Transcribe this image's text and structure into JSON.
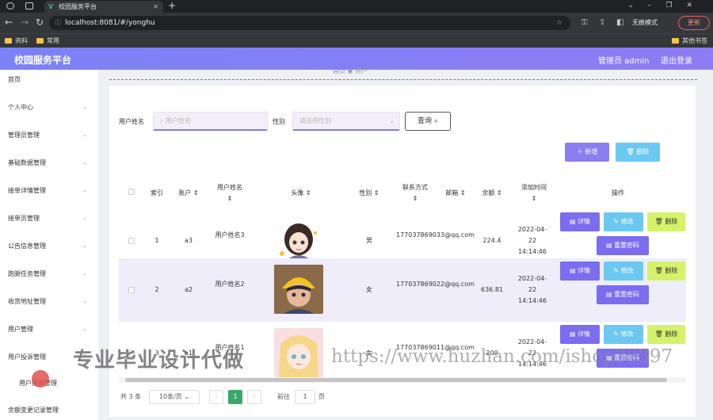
{
  "browser": {
    "tab_title": "校园服务平台",
    "url": "localhost:8081/#/yonghu",
    "incognito_label": "无痕模式",
    "update_label": "更新",
    "bookmarks": [
      "资料",
      "常用"
    ],
    "other_bookmarks": "其他书签"
  },
  "header": {
    "brand": "校园服务平台",
    "user": "管理员 admin",
    "logout": "退出登录"
  },
  "sidebar": {
    "items": [
      "首页",
      "个人中心",
      "管理员管理",
      "基础数据管理",
      "接单详情管理",
      "接单员管理",
      "公告信息管理",
      "跑腿任务管理",
      "收货地址管理",
      "用户管理",
      "用户投诉管理"
    ],
    "sub_item": "用户投诉管理",
    "last_item": "余额变更记录管理"
  },
  "breadcrumb": {
    "home": "首页",
    "current": "用户"
  },
  "search": {
    "name_label": "用户姓名",
    "name_placeholder": "用户姓名",
    "gender_label": "性别",
    "gender_placeholder": "请选择性别",
    "query_button": "查询"
  },
  "actions": {
    "add": "新增",
    "delete": "删除"
  },
  "table": {
    "columns": [
      "索引",
      "账户",
      "用户姓名",
      "头像",
      "性别",
      "联系方式",
      "邮箱",
      "余额",
      "添加时间",
      "操作"
    ],
    "rows": [
      {
        "index": "1",
        "account": "a3",
        "name": "用户姓名3",
        "gender": "男",
        "phone": "17703786903",
        "email": "3@qq.com",
        "balance": "224.4",
        "time": "2022-04-22 14:14:46"
      },
      {
        "index": "2",
        "account": "a2",
        "name": "用户姓名2",
        "gender": "女",
        "phone": "17703786902",
        "email": "2@qq.com",
        "balance": "636.81",
        "time": "2022-04-22 14:14:46"
      },
      {
        "index": "3",
        "account": "a1",
        "name": "用户姓名1",
        "gender": "女",
        "phone": "17703786901",
        "email": "1@qq.com",
        "balance": "200",
        "time": "2022-04-22 14:14:46"
      }
    ],
    "row_actions": {
      "detail": "详情",
      "edit": "修改",
      "delete": "删除",
      "reset": "重置密码"
    }
  },
  "pagination": {
    "total": "共 3 条",
    "page_size": "10条/页",
    "current_page": "1",
    "goto_label": "前往",
    "goto_value": "1",
    "page_suffix": "页"
  },
  "watermark": {
    "text": "专业毕业设计代做",
    "url": "https://www.huzhan.com/ishop39397"
  },
  "colors": {
    "header": "#7b82f5",
    "primary_button": "#7b6cf0",
    "edit_button": "#6cc8f0",
    "delete_button": "#d4f26a"
  }
}
